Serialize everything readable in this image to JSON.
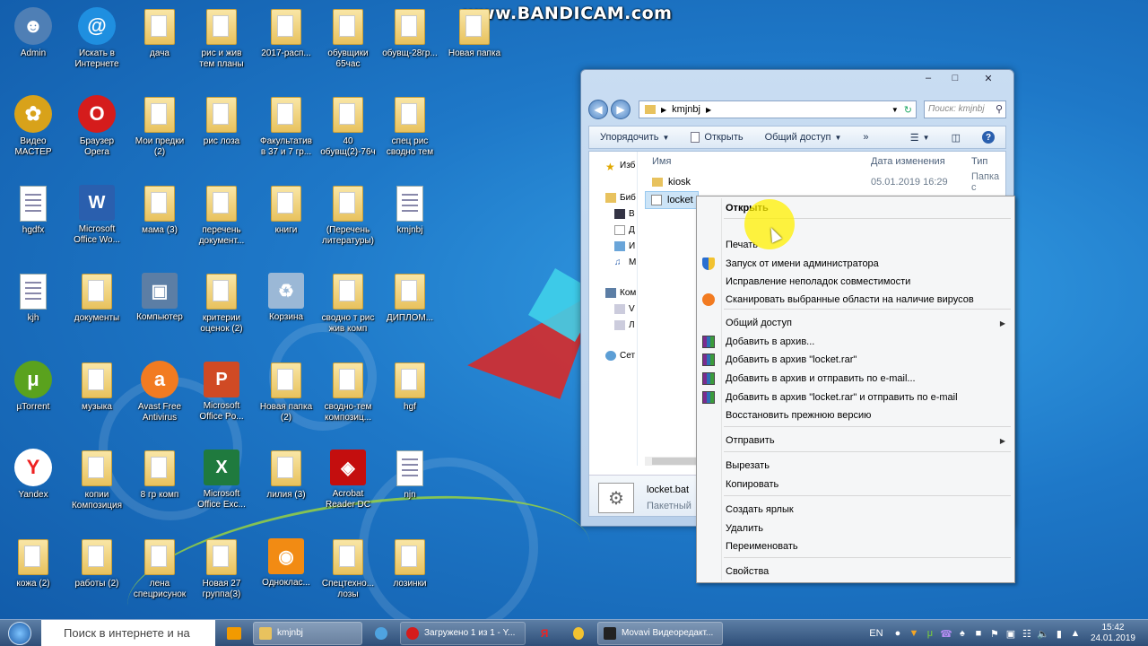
{
  "watermark": "www.BANDICAM.com",
  "desktop_icons": [
    {
      "label": "Admin",
      "icon": "user-icon",
      "x": 0,
      "y": 0
    },
    {
      "label": "Искать в\nИнтернете",
      "icon": "ie-search-icon"
    },
    {
      "label": "дача",
      "icon": "folder-icon"
    },
    {
      "label": "рис и жив\nтем планы",
      "icon": "folder-icon"
    },
    {
      "label": "2017-расп...",
      "icon": "folder-icon"
    },
    {
      "label": "обувщики\n65час",
      "icon": "folder-icon"
    },
    {
      "label": "обувщ-28гр...",
      "icon": "folder-icon"
    },
    {
      "label": "Новая папка",
      "icon": "folder-icon"
    },
    {
      "label": "Видео\nМАСТЕР",
      "icon": "video-master-icon"
    },
    {
      "label": "Браузер\nOpera",
      "icon": "opera-icon"
    },
    {
      "label": "Мои предки\n(2)",
      "icon": "folder-icon"
    },
    {
      "label": "рис лоза",
      "icon": "folder-icon"
    },
    {
      "label": "Факультатив\nв 37 и 7 гр...",
      "icon": "folder-icon"
    },
    {
      "label": "40\nобувщ(2)-76ч",
      "icon": "folder-icon"
    },
    {
      "label": "спец рис\nсводно тем",
      "icon": "folder-icon"
    },
    {
      "label": "hgdfx",
      "icon": "file-icon"
    },
    {
      "label": "Microsoft\nOffice Wo...",
      "icon": "word-icon"
    },
    {
      "label": "мама (3)",
      "icon": "folder-icon"
    },
    {
      "label": "перечень\nдокумент...",
      "icon": "folder-icon"
    },
    {
      "label": "книги",
      "icon": "folder-icon"
    },
    {
      "label": "(Перечень\nлитературы)",
      "icon": "folder-icon"
    },
    {
      "label": "kmjnbj",
      "icon": "file-icon"
    },
    {
      "label": "kjh",
      "icon": "file-icon"
    },
    {
      "label": "документы",
      "icon": "folder-icon"
    },
    {
      "label": "Компьютер",
      "icon": "computer-icon"
    },
    {
      "label": "критерии\nоценок (2)",
      "icon": "folder-icon"
    },
    {
      "label": "Корзина",
      "icon": "recycle-bin-icon"
    },
    {
      "label": "сводно т рис\nжив комп",
      "icon": "folder-icon"
    },
    {
      "label": "ДИПЛОМ...",
      "icon": "folder-icon"
    },
    {
      "label": "µTorrent",
      "icon": "utorrent-icon"
    },
    {
      "label": "музыка",
      "icon": "folder-icon"
    },
    {
      "label": "Avast Free\nAntivirus",
      "icon": "avast-icon"
    },
    {
      "label": "Microsoft\nOffice Po...",
      "icon": "powerpoint-icon"
    },
    {
      "label": "Новая папка\n(2)",
      "icon": "folder-icon"
    },
    {
      "label": "сводно-тем\nкомпозиц...",
      "icon": "folder-icon"
    },
    {
      "label": "hgf",
      "icon": "folder-icon"
    },
    {
      "label": "Yandex",
      "icon": "yandex-icon"
    },
    {
      "label": "копии\nКомпозиция",
      "icon": "folder-icon"
    },
    {
      "label": "8 гр комп",
      "icon": "folder-icon"
    },
    {
      "label": "Microsoft\nOffice Exc...",
      "icon": "excel-icon"
    },
    {
      "label": "лилия (3)",
      "icon": "folder-icon"
    },
    {
      "label": "Acrobat\nReader DC",
      "icon": "acrobat-icon"
    },
    {
      "label": "njn",
      "icon": "file-icon"
    },
    {
      "label": "кожа (2)",
      "icon": "folder-icon"
    },
    {
      "label": "работы (2)",
      "icon": "folder-icon"
    },
    {
      "label": "лена\nспецрисунок",
      "icon": "folder-icon"
    },
    {
      "label": "Новая 27\nгруппа(3)",
      "icon": "folder-icon"
    },
    {
      "label": "Одноклас...",
      "icon": "odnoklassniki-icon"
    },
    {
      "label": "Спецтехно...\nлозы",
      "icon": "folder-icon"
    },
    {
      "label": "лозинки",
      "icon": "folder-icon"
    }
  ],
  "explorer": {
    "breadcrumb": "kmjnbj",
    "search_placeholder": "Поиск: kmjnbj",
    "toolbar": {
      "organize": "Упорядочить",
      "open": "Открыть",
      "share": "Общий доступ",
      "more": "»"
    },
    "columns": {
      "name": "Имя",
      "date": "Дата изменения",
      "type": "Тип"
    },
    "nav_items": [
      "Избранное",
      "Библиотеки",
      "Видео",
      "Документы",
      "Изображения",
      "Музыка",
      "Компьютер",
      "V",
      "Л",
      "Сеть"
    ],
    "nav_visible": [
      "Изб",
      "Биб",
      "В",
      "Д",
      "И",
      "М",
      "Ком",
      "V",
      "Л",
      "Сет"
    ],
    "rows": [
      {
        "name": "kiosk",
        "date": "05.01.2019 16:29",
        "type": "Папка с"
      },
      {
        "name": "locket",
        "date": "",
        "type": ""
      }
    ],
    "details": {
      "name": "locket.bat",
      "type": "Пакетный"
    }
  },
  "context_menu": {
    "items": [
      {
        "label": "Открыть",
        "bold": true
      },
      {
        "label": "Печать"
      },
      {
        "label": "Запуск от имени администратора",
        "icon": "shield-icon"
      },
      {
        "label": "Исправление неполадок совместимости"
      },
      {
        "label": "Сканировать выбранные области на наличие вирусов",
        "icon": "avast-icon"
      },
      {
        "label": "Общий доступ",
        "submenu": true
      },
      {
        "label": "Добавить в архив...",
        "icon": "winrar-icon"
      },
      {
        "label": "Добавить в архив \"locket.rar\"",
        "icon": "winrar-icon"
      },
      {
        "label": "Добавить в архив и отправить по e-mail...",
        "icon": "winrar-icon"
      },
      {
        "label": "Добавить в архив \"locket.rar\" и отправить по e-mail",
        "icon": "winrar-icon"
      },
      {
        "label": "Восстановить прежнюю версию"
      },
      {
        "label": "Отправить",
        "submenu": true
      },
      {
        "label": "Вырезать"
      },
      {
        "label": "Копировать"
      },
      {
        "label": "Создать ярлык"
      },
      {
        "label": "Удалить"
      },
      {
        "label": "Переименовать"
      },
      {
        "label": "Свойства"
      }
    ]
  },
  "taskbar": {
    "search_placeholder": "Поиск в интернете и на",
    "items": [
      {
        "label": "kmjnbj"
      },
      {
        "label": "Загружено 1 из 1 - Y..."
      },
      {
        "label": "Movavi Видеоредакт..."
      }
    ],
    "lang": "EN",
    "time": "15:42",
    "date": "24.01.2019"
  }
}
